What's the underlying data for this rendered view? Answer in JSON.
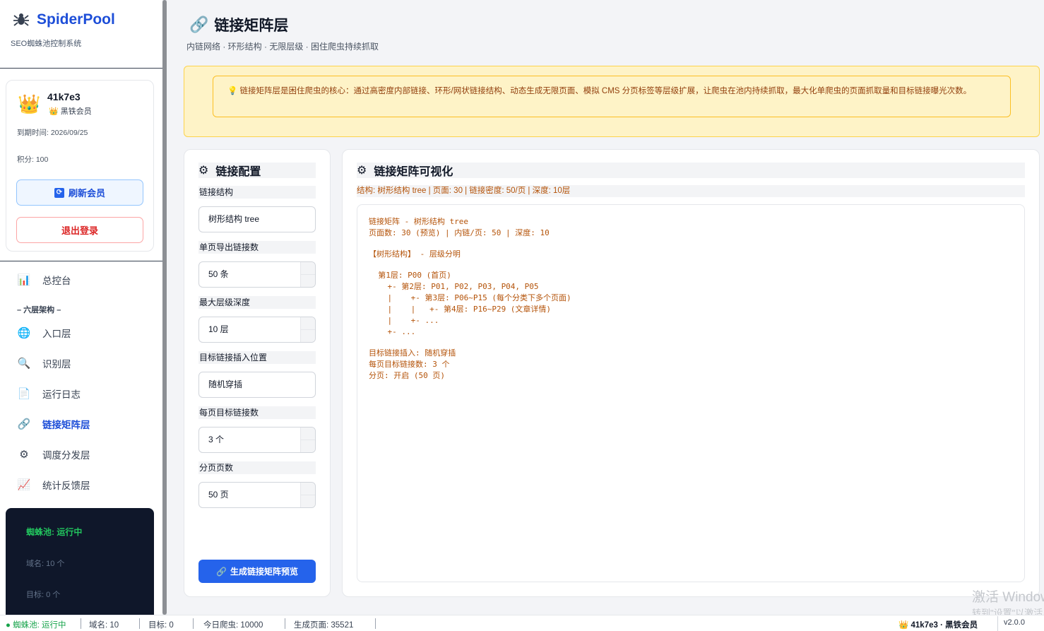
{
  "brand": {
    "title": "SpiderPool",
    "subtitle": "SEO蜘蛛池控制系统"
  },
  "user": {
    "name": "41k7e3",
    "level": "👑 黑铁会员",
    "expire": "到期时间: 2026/09/25",
    "points": "积分: 100",
    "refresh_label": "刷新会员",
    "logout_label": "退出登录"
  },
  "nav": {
    "section_label": "– 六层架构 –",
    "items": [
      {
        "icon": "📊",
        "label": "总控台"
      },
      {
        "icon": "🌐",
        "label": "入口层"
      },
      {
        "icon": "🔍",
        "label": "识别层"
      },
      {
        "icon": "📄",
        "label": "运行日志"
      },
      {
        "icon": "🔗",
        "label": "链接矩阵层"
      },
      {
        "icon": "⚙",
        "label": "调度分发层"
      },
      {
        "icon": "📈",
        "label": "统计反馈层"
      }
    ]
  },
  "status_panel": {
    "running": "蜘蛛池: 运行中",
    "domains": "域名: 10 个",
    "targets": "目标: 0 个"
  },
  "page": {
    "title": "链接矩阵层",
    "subtitle": "内链网络 · 环形结构 · 无限层级 · 困住爬虫持续抓取",
    "notice": "💡 链接矩阵层是困住爬虫的核心：通过高密度内部链接、环形/网状链接结构、动态生成无限页面、模拟 CMS 分页标签等层级扩展，让爬虫在池内持续抓取，最大化单爬虫的页面抓取量和目标链接曝光次数。"
  },
  "config": {
    "title": "链接配置",
    "fields": [
      {
        "label": "链接结构",
        "value": "树形结构 tree"
      },
      {
        "label": "单页导出链接数",
        "value": "50 条"
      },
      {
        "label": "最大层级深度",
        "value": "10 层"
      },
      {
        "label": "目标链接插入位置",
        "value": "随机穿插"
      },
      {
        "label": "每页目标链接数",
        "value": "3 个"
      },
      {
        "label": "分页页数",
        "value": "50 页"
      }
    ],
    "generate_label": "生成链接矩阵预览"
  },
  "viz": {
    "title": "链接矩阵可视化",
    "meta": "结构: 树形结构 tree | 页面: 30 | 链接密度: 50/页 | 深度: 10层",
    "lines": [
      "链接矩阵 - 树形结构 tree",
      "页面数: 30 (预览) | 内链/页: 50 | 深度: 10",
      "",
      "【树形结构】 - 层级分明",
      "",
      "  第1层: P00 (首页)",
      "    +- 第2层: P01, P02, P03, P04, P05",
      "    |    +- 第3层: P06~P15 (每个分类下多个页面)",
      "    |    |   +- 第4层: P16~P29 (文章详情)",
      "    |    +- ...",
      "    +- ...",
      "",
      "目标链接插入: 随机穿插",
      "每页目标链接数: 3 个",
      "分页: 开启 (50 页)"
    ]
  },
  "statusbar": {
    "running": "● 蜘蛛池: 运行中",
    "domains": "域名: 10",
    "targets": "目标: 0",
    "crawls": "今日爬虫: 10000",
    "pages": "生成页面: 35521",
    "user": "👑 41k7e3 · 黑铁会员",
    "version": "v2.0.0"
  },
  "watermark": {
    "line1": "激活 Windows",
    "line2": "转到\"设置\"以激活 Windows。"
  }
}
